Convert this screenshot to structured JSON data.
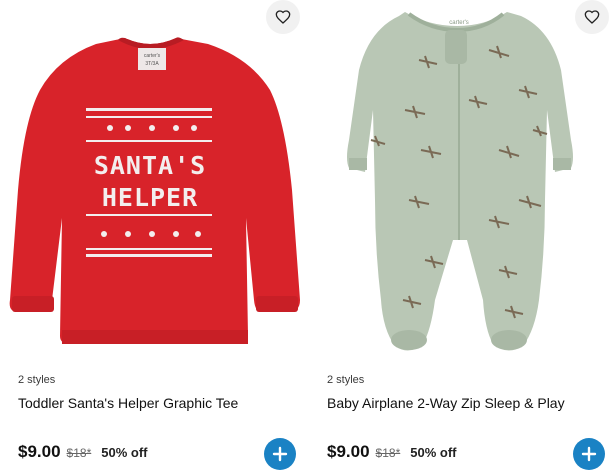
{
  "products": [
    {
      "styles_text": "2 styles",
      "name": "Toddler Santa's Helper Graphic Tee",
      "price": "$9.00",
      "original_price": "$18*",
      "discount": "50% off",
      "image": {
        "tag_line1": "carter's",
        "tag_line2": "3T/3A",
        "graphic_line1": "SANTA'S",
        "graphic_line2": "HELPER",
        "colors": {
          "shirt": "#d8232a",
          "shirt_dark": "#b81c23",
          "print": "#f3eeee"
        }
      }
    },
    {
      "styles_text": "2 styles",
      "name": "Baby Airplane 2-Way Zip Sleep & Play",
      "price": "$9.00",
      "original_price": "$18*",
      "discount": "50% off",
      "image": {
        "tag_line1": "carter's",
        "colors": {
          "fabric": "#b9c7b5",
          "fabric_dark": "#9fb09b",
          "planes": "#7a6a55"
        }
      }
    }
  ],
  "icons": {
    "favorite": "heart-outline-icon",
    "add": "plus-icon"
  },
  "accent_color": "#1a82c4"
}
